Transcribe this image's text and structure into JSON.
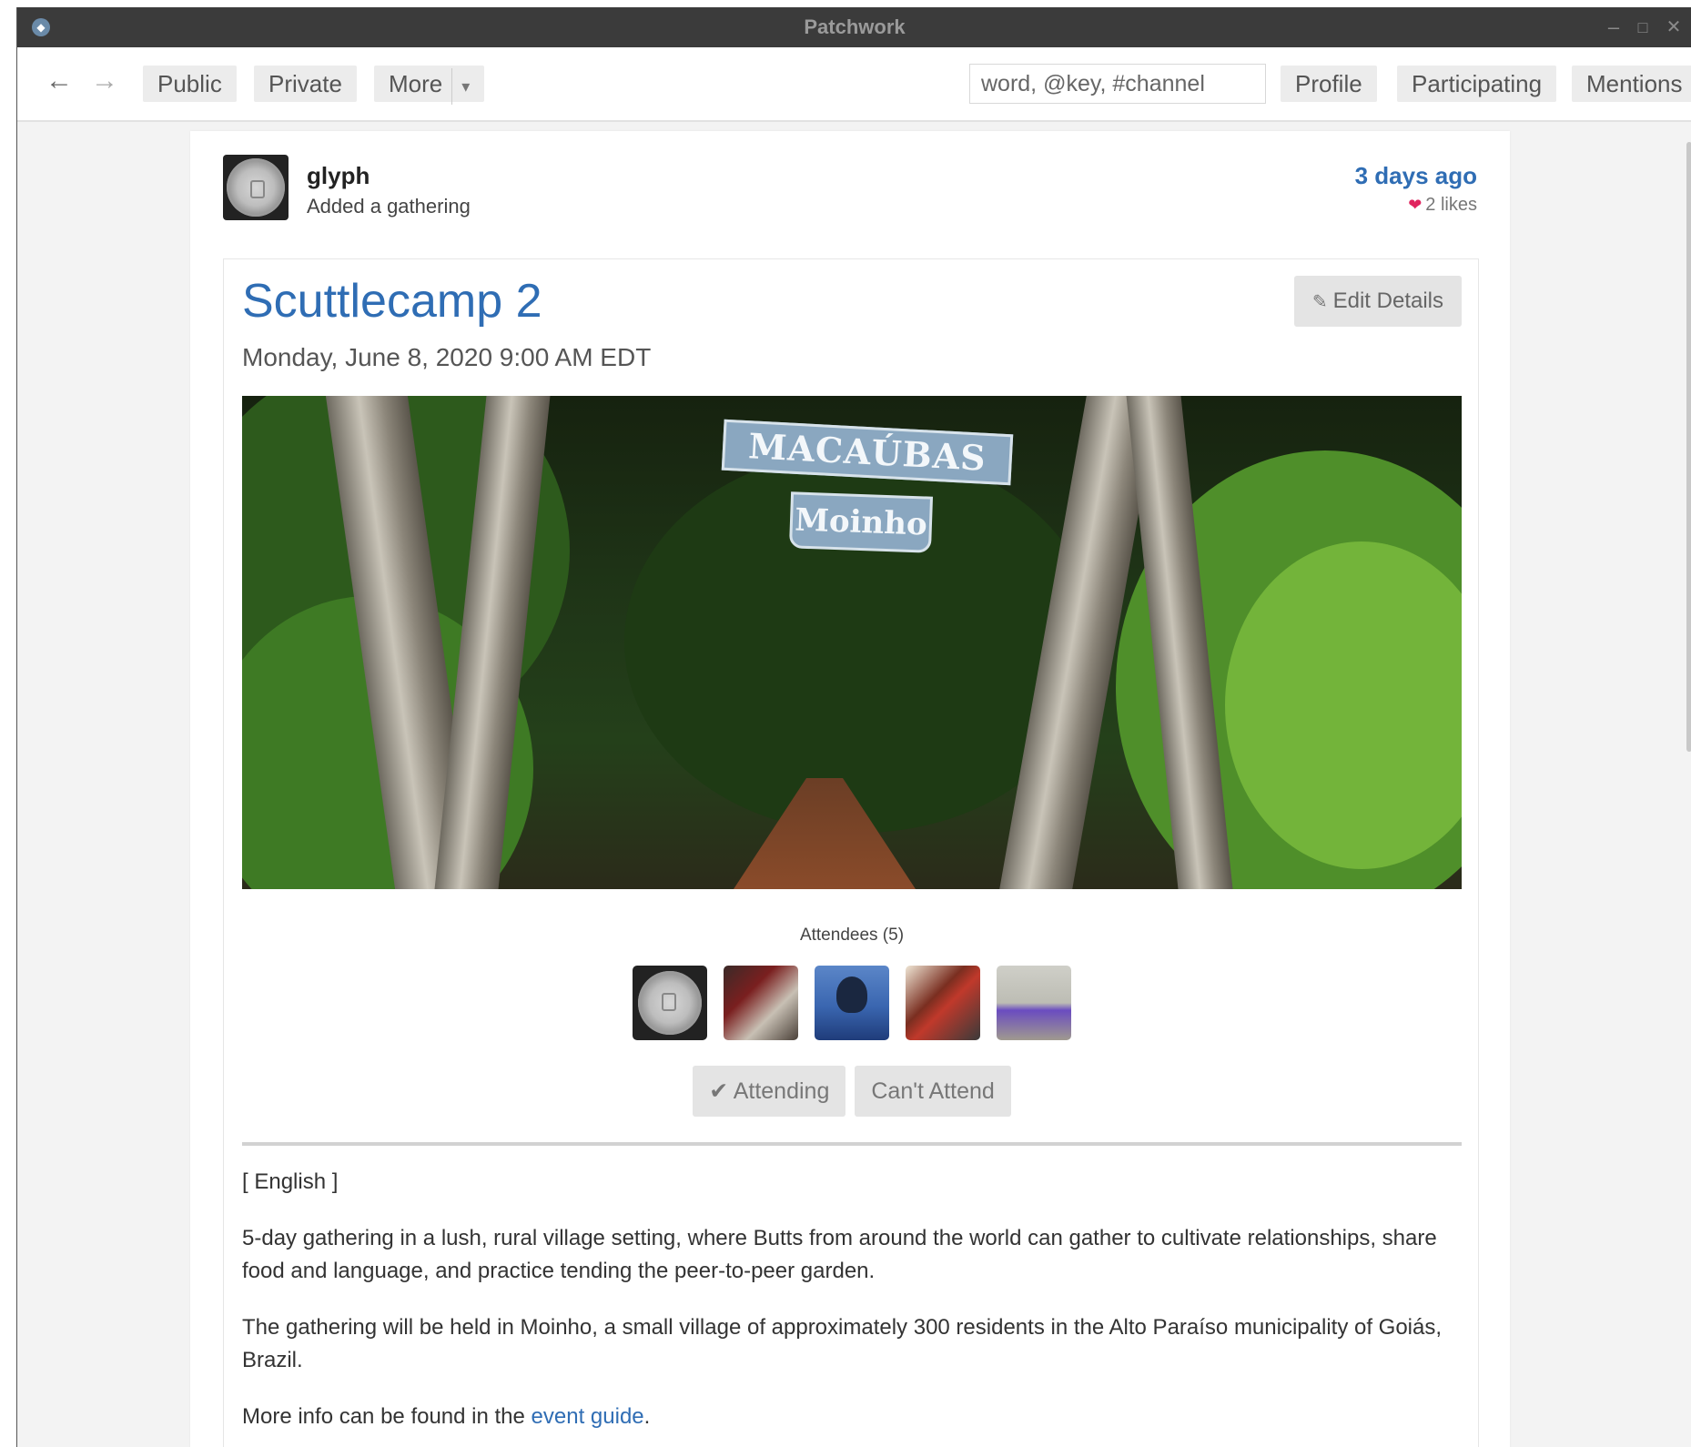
{
  "window": {
    "title": "Patchwork",
    "controls": {
      "minimize": "–",
      "maximize": "□",
      "close": "✕"
    }
  },
  "nav": {
    "back_icon": "←",
    "forward_icon": "→",
    "public_label": "Public",
    "private_label": "Private",
    "more_label": "More",
    "more_caret": "▾",
    "search_placeholder": "word, @key, #channel",
    "profile_label": "Profile",
    "participating_label": "Participating",
    "mentions_label": "Mentions"
  },
  "post": {
    "author": "glyph",
    "action": "Added a gathering",
    "time": "3 days ago",
    "likes": "2 likes",
    "heart_icon": "❤"
  },
  "gathering": {
    "title": "Scuttlecamp 2",
    "date": "Monday, June 8, 2020 9:00 AM EDT",
    "edit_label": "Edit Details",
    "edit_icon": "✎",
    "image_sign_top": "MACAÚBAS",
    "image_sign_bottom": "Moinho",
    "attendees_label": "Attendees (5)",
    "attending_label": "✔ Attending",
    "cant_attend_label": "Can't Attend"
  },
  "description": {
    "lang": "[ English ]",
    "para1": "5-day gathering in a lush, rural village setting, where Butts from around the world can gather to cultivate relationships, share food and language, and practice tending the peer-to-peer garden.",
    "para2": "The gathering will be held in Moinho, a small village of approximately 300 residents in the Alto Paraíso municipality of Goiás, Brazil.",
    "para3_prefix": "More info can be found in the ",
    "para3_link": "event guide",
    "para3_suffix": "."
  },
  "colors": {
    "accent": "#2f6db4",
    "titlebar": "#3b3b3b",
    "button_bg": "#ececec",
    "heart": "#e0245e"
  }
}
